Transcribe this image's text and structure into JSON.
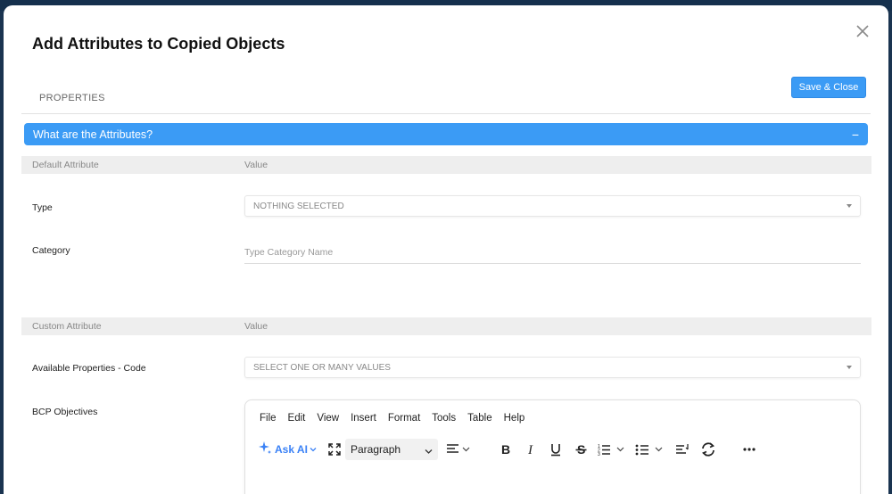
{
  "dialog": {
    "title": "Add Attributes to Copied Objects",
    "save_label": "Save & Close",
    "tab_label": "PROPERTIES"
  },
  "section": {
    "title": "What are the Attributes?",
    "toggle": "−"
  },
  "default_header": {
    "col1": "Default Attribute",
    "col2": "Value"
  },
  "fields": {
    "type_label": "Type",
    "type_value": "NOTHING SELECTED",
    "category_label": "Category",
    "category_placeholder": "Type Category Name"
  },
  "custom_header": {
    "col1": "Custom Attribute",
    "col2": "Value"
  },
  "custom": {
    "properties_label": "Available Properties - Code",
    "properties_value": "SELECT ONE OR MANY VALUES",
    "bcp_label": "BCP Objectives"
  },
  "editor": {
    "menu": [
      "File",
      "Edit",
      "View",
      "Insert",
      "Format",
      "Tools",
      "Table",
      "Help"
    ],
    "ask_ai": "Ask AI",
    "block_format": "Paragraph",
    "icons": [
      "sparkle-icon",
      "fullscreen-icon",
      "align-left-icon",
      "bold-icon",
      "italic-icon",
      "underline-icon",
      "strikethrough-icon",
      "numbered-list-icon",
      "bullet-list-icon",
      "line-height-icon",
      "refresh-icon",
      "more-icon"
    ]
  },
  "colors": {
    "accent": "#3b9bf5",
    "backdrop": "#1a3450"
  }
}
